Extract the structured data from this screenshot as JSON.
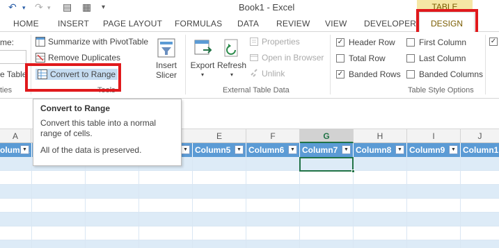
{
  "titlebar": {
    "title": "Book1 - Excel",
    "contextual_tab_group": "TABLE TOOLS"
  },
  "tabs": [
    "HOME",
    "INSERT",
    "PAGE LAYOUT",
    "FORMULAS",
    "DATA",
    "REVIEW",
    "VIEW",
    "DEVELOPER",
    "DESIGN"
  ],
  "ribbon": {
    "partial_left": {
      "label_top": "me:",
      "label_mid": "e Table",
      "group": "ties"
    },
    "tools": {
      "summarize": "Summarize with PivotTable",
      "remove_duplicates": "Remove Duplicates",
      "convert_to_range": "Convert to Range",
      "group_label": "Tools"
    },
    "insert_slicer": {
      "line1": "Insert",
      "line2": "Slicer"
    },
    "external": {
      "export": "Export",
      "refresh": "Refresh",
      "properties": "Properties",
      "open_in_browser": "Open in Browser",
      "unlink": "Unlink",
      "group_label": "External Table Data"
    },
    "style_options": {
      "header_row": "Header Row",
      "total_row": "Total Row",
      "banded_rows": "Banded Rows",
      "first_column": "First Column",
      "last_column": "Last Column",
      "banded_columns": "Banded Columns",
      "group_label": "Table Style Options",
      "checked": {
        "header_row": true,
        "total_row": false,
        "banded_rows": true,
        "first_column": false,
        "last_column": false,
        "banded_columns": false
      }
    }
  },
  "tooltip": {
    "title": "Convert to Range",
    "desc_line1": "Convert this table into a normal",
    "desc_line2": "range of cells.",
    "note": "All of the data is preserved."
  },
  "columns": [
    "A",
    "E",
    "F",
    "G",
    "H",
    "I",
    "J"
  ],
  "table_headers": [
    "olumn1",
    "Column5",
    "Column6",
    "Column7",
    "Column8",
    "Column9",
    "Column1"
  ],
  "colors": {
    "excel_green": "#217346",
    "table_header": "#5b9bd5",
    "band": "#ddebf7",
    "highlight": "#e0191c",
    "contextual": "#f5e7a5"
  }
}
